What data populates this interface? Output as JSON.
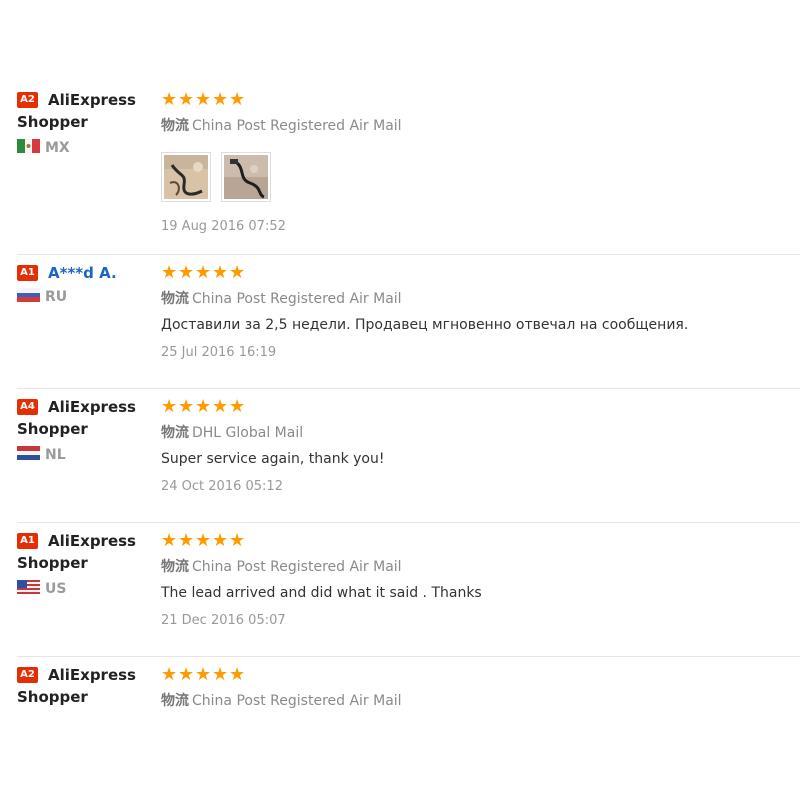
{
  "feedback": [
    {
      "level": "A2",
      "name": "AliExpress Shopper",
      "name_style": "plain",
      "country": "MX",
      "rating": 5,
      "stars": "★★★★★",
      "logistics_label": "物流",
      "logistics": "China Post Registered Air Mail",
      "comment": "",
      "date": "19 Aug 2016 07:52",
      "photos": [
        "photo-1",
        "photo-2"
      ]
    },
    {
      "level": "A1",
      "name": "A***d A.",
      "name_style": "link",
      "country": "RU",
      "rating": 5,
      "stars": "★★★★★",
      "logistics_label": "物流",
      "logistics": "China Post Registered Air Mail",
      "comment": "Доставили за 2,5 недели. Продавец мгновенно отвечал на сообщения.",
      "date": "25 Jul 2016 16:19"
    },
    {
      "level": "A4",
      "name": "AliExpress Shopper",
      "name_style": "plain",
      "country": "NL",
      "rating": 5,
      "stars": "★★★★★",
      "logistics_label": "物流",
      "logistics": "DHL Global Mail",
      "comment": "Super service again, thank you!",
      "date": "24 Oct 2016 05:12"
    },
    {
      "level": "A1",
      "name": "AliExpress Shopper",
      "name_style": "plain",
      "country": "US",
      "rating": 5,
      "stars": "★★★★★",
      "logistics_label": "物流",
      "logistics": "China Post Registered Air Mail",
      "comment": "The lead arrived and did what it said . Thanks",
      "date": "21 Dec 2016 05:07"
    },
    {
      "level": "A2",
      "name": "AliExpress Shopper",
      "name_style": "plain",
      "country": "",
      "rating": 5,
      "stars": "★★★★★",
      "logistics_label": "物流",
      "logistics": "China Post Registered Air Mail",
      "comment": "",
      "date": ""
    }
  ],
  "colors": {
    "star": "#ff9a00",
    "badge": "#e62e04",
    "link": "#1a66c2",
    "divider": "#e6e6e6",
    "muted": "#999999"
  }
}
